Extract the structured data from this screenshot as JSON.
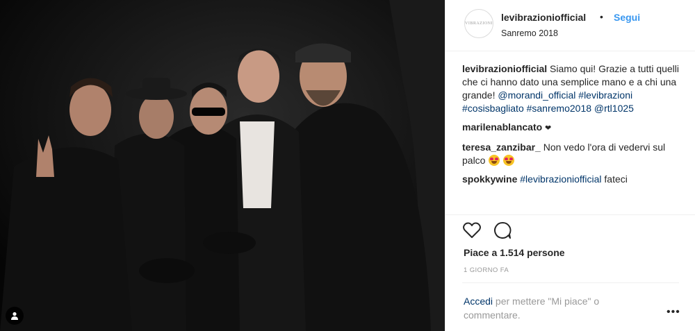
{
  "post": {
    "username": "levibrazioniofficial",
    "dot": "•",
    "follow_label": "Segui",
    "location": "Sanremo 2018",
    "avatar_text": "VIBRAZIONI"
  },
  "comments": [
    {
      "user": "levibrazioniofficial",
      "text": "Siamo qui! Grazie a tutti quelli che ci hanno dato una semplice mano e a chi una grande!",
      "mention": "@morandi_official",
      "hashtags": "#levibrazioni #cosisbagliato #sanremo2018",
      "mention2": "@rtl1025"
    },
    {
      "user": "marilenablancato",
      "text": "❤"
    },
    {
      "user": "teresa_zanzibar_",
      "text": "Non vedo l'ora di vedervi sul palco"
    },
    {
      "user": "spokkywine",
      "hashtag": "#levibrazioniofficial",
      "text": "fateci"
    }
  ],
  "icons": {
    "like": "heart-icon",
    "comment": "comment-icon",
    "tag": "user-tag-icon",
    "more": "more-options-icon"
  },
  "likes": "Piace a 1.514 persone",
  "time_ago": "1 GIORNO FA",
  "login_prompt": {
    "link": "Accedi",
    "rest": "per mettere \"Mi piace\" o commentare."
  },
  "more_label": "•••"
}
